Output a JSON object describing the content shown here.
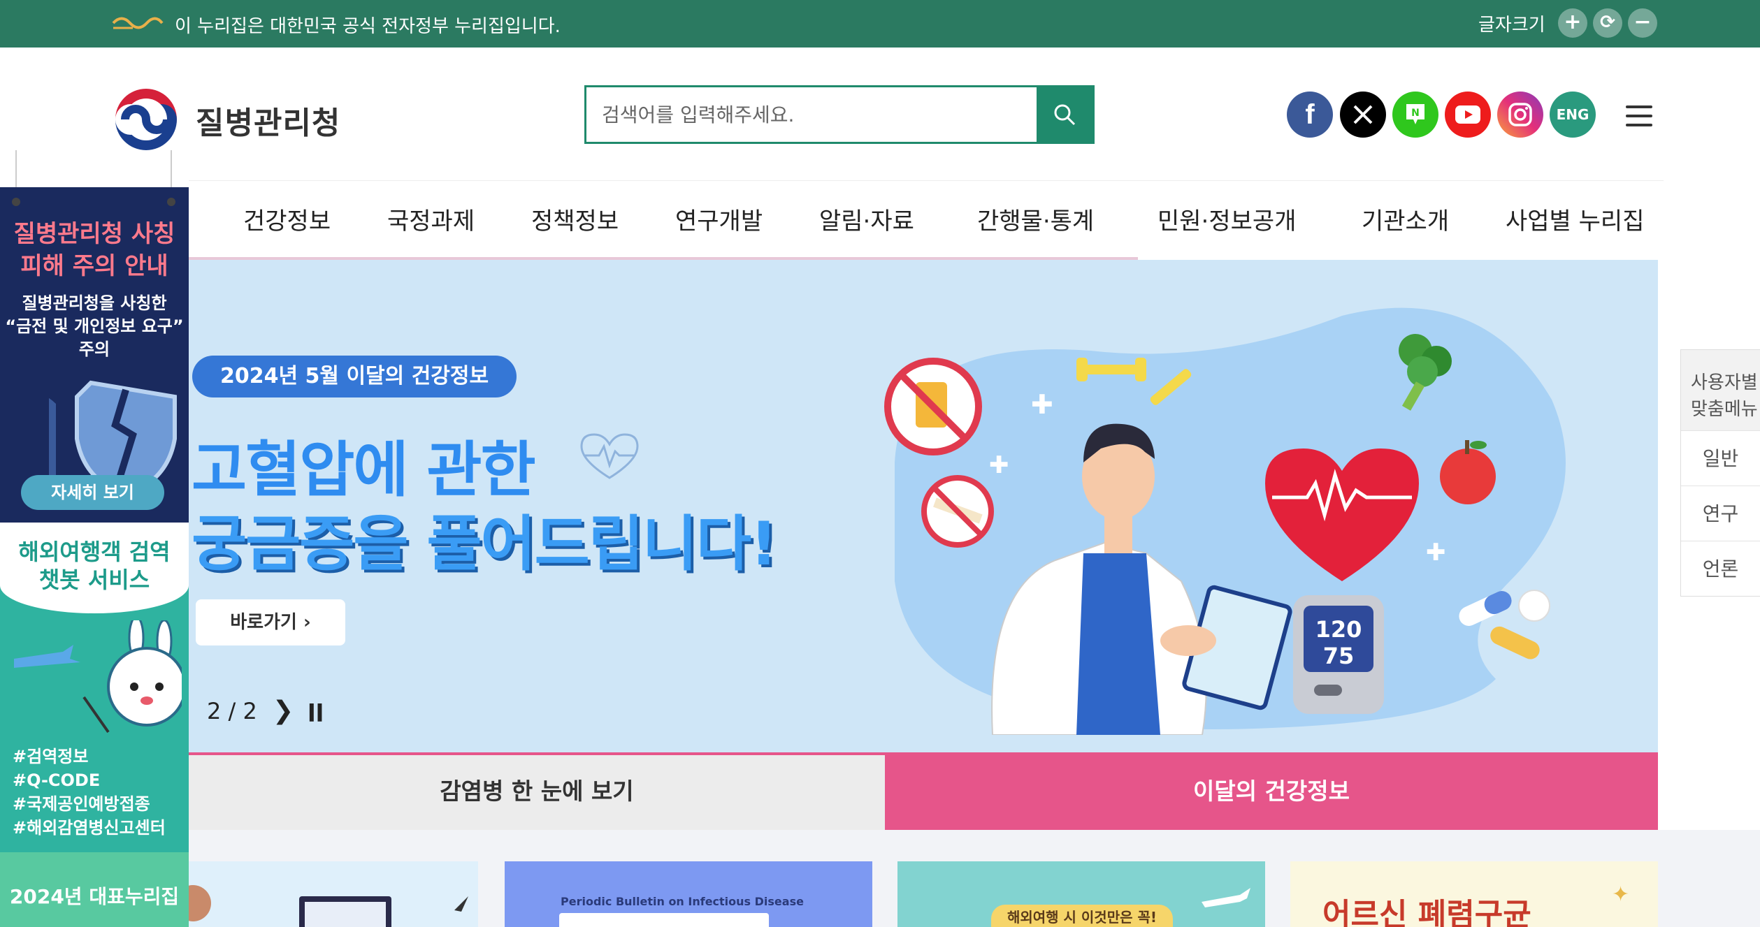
{
  "gov_bar": {
    "notice": "이 누리집은 대한민국 공식 전자정부 누리집입니다.",
    "font_size_label": "글자크기",
    "buttons": [
      "+",
      "⟳",
      "−"
    ]
  },
  "header": {
    "logo_text": "질병관리청",
    "search_placeholder": "검색어를 입력해주세요.",
    "lang_button": "ENG"
  },
  "gnb": [
    "건강정보",
    "국정과제",
    "정책정보",
    "연구개발",
    "알림·자료",
    "간행물·통계",
    "민원·정보공개",
    "기관소개",
    "사업별 누리집"
  ],
  "left_banners": {
    "b1_title_line1": "질병관리청 사칭",
    "b1_title_line2": "피해 주의 안내",
    "b1_text_line1": "질병관리청을 사칭한",
    "b1_text_line2": "“금전 및 개인정보 요구”",
    "b1_text_line3": "주의",
    "b1_button": "자세히 보기",
    "b2_title_line1": "해외여행객 검역",
    "b2_title_line2": "챗봇 서비스",
    "b2_tags": [
      "#검역정보",
      "#Q-CODE",
      "#국제공인예방접종",
      "#해외감염병신고센터"
    ],
    "b3_title": "2024년 대표누리집"
  },
  "hero": {
    "badge": "2024년 5월 이달의 건강정보",
    "title_line1": "고혈압에 관한",
    "title_line2": "궁금증을 풀어드립니다!",
    "button": "바로가기",
    "counter": "2 / 2",
    "next_icon": "❯",
    "pause_icon": "ll",
    "bp_top": "120",
    "bp_bottom": "75"
  },
  "tabs": {
    "left": "감염병 한 눈에 보기",
    "right": "이달의 건강정보"
  },
  "thumbs": {
    "t2_small": "Periodic Bulletin on Infectious Disease",
    "t3_label": "해외여행 시 이것만은 꼭!",
    "t4_label": "어르신 폐렴구균"
  },
  "quick_menu": {
    "head_line1": "사용자별",
    "head_line2": "맞춤메뉴",
    "items": [
      "일반",
      "연구",
      "언론"
    ]
  },
  "colors": {
    "gov_bar": "#2b7a61",
    "search_accent": "#1f8a6c",
    "hero_bg": "#cfe6f7",
    "tab_active": "#e6558a"
  }
}
